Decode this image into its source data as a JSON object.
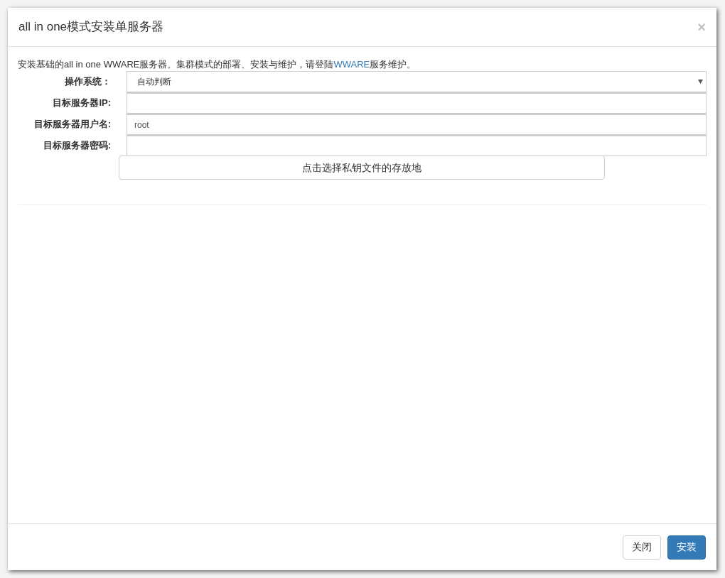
{
  "dialog": {
    "title": "all in one模式安装单服务器",
    "close": "×"
  },
  "intro": {
    "before": "安装基础的all in one WWARE服务器。集群模式的部署、安装与维护，请登陆",
    "link": "WWARE",
    "after": "服务维护。"
  },
  "fields": [
    {
      "kind": "select",
      "label": "操作系统：",
      "value": "自动判断"
    },
    {
      "kind": "input",
      "label": "目标服务器IP:"
    },
    {
      "kind": "input",
      "label": "目标服务器用户名:",
      "value": "root"
    },
    {
      "kind": "input",
      "label": "目标服务器密码:"
    }
  ],
  "key_file_button": "点击选择私钥文件的存放地",
  "buttons": [
    {
      "label": "关闭",
      "primary": false
    },
    {
      "label": "安装",
      "primary": true
    }
  ]
}
